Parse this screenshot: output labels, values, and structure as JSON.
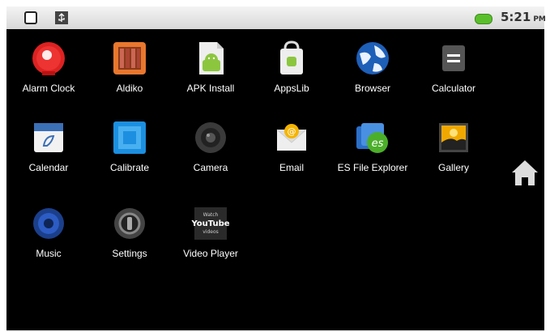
{
  "status_bar": {
    "time": "5:21",
    "ampm": "PM",
    "left_icons": [
      "square-notification-icon",
      "usb-icon"
    ],
    "battery_color": "#5bbf2c"
  },
  "apps": [
    {
      "label": "Alarm Clock",
      "icon": "alarm-clock-icon"
    },
    {
      "label": "Aldiko",
      "icon": "aldiko-icon"
    },
    {
      "label": "APK Install",
      "icon": "apk-install-icon"
    },
    {
      "label": "AppsLib",
      "icon": "appslib-icon"
    },
    {
      "label": "Browser",
      "icon": "browser-icon"
    },
    {
      "label": "Calculator",
      "icon": "calculator-icon"
    },
    {
      "label": "Calendar",
      "icon": "calendar-icon"
    },
    {
      "label": "Calibrate",
      "icon": "calibrate-icon"
    },
    {
      "label": "Camera",
      "icon": "camera-icon"
    },
    {
      "label": "Email",
      "icon": "email-icon"
    },
    {
      "label": "ES File Explorer",
      "icon": "es-file-explorer-icon"
    },
    {
      "label": "Gallery",
      "icon": "gallery-icon"
    },
    {
      "label": "Music",
      "icon": "music-icon"
    },
    {
      "label": "Settings",
      "icon": "settings-icon"
    },
    {
      "label": "Video Player",
      "icon": "video-player-icon",
      "icon_text": [
        "Watch",
        "YouTube",
        "videos"
      ]
    }
  ],
  "home_button": {
    "icon": "home-icon"
  }
}
